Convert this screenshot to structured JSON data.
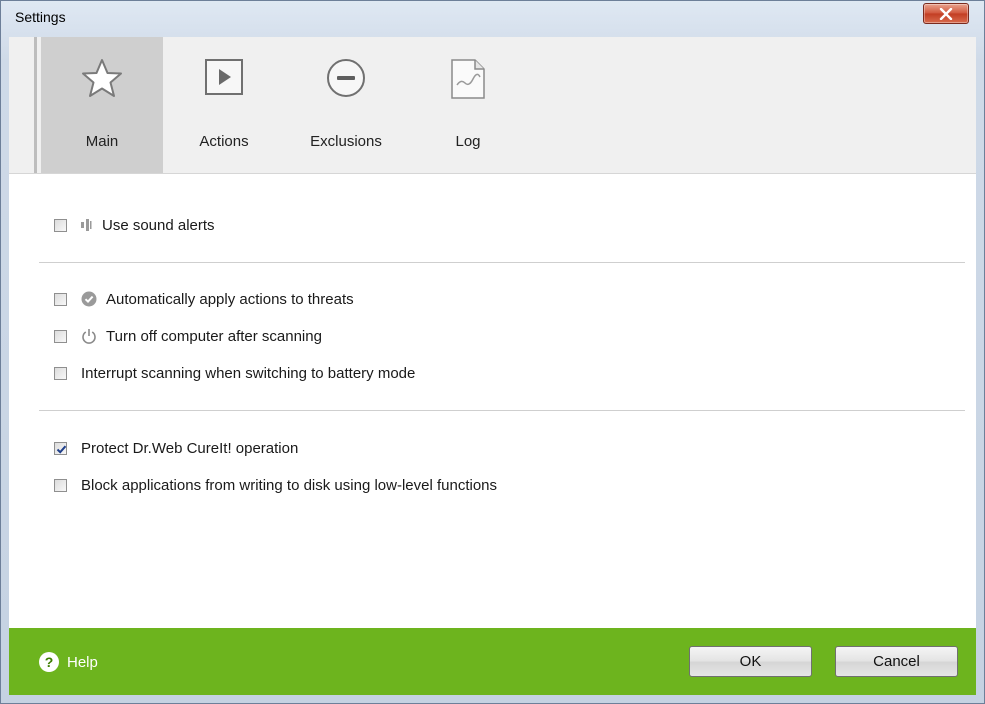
{
  "window": {
    "title": "Settings"
  },
  "tabs": [
    {
      "label": "Main",
      "icon": "star-icon",
      "active": true
    },
    {
      "label": "Actions",
      "icon": "play-icon",
      "active": false
    },
    {
      "label": "Exclusions",
      "icon": "minus-circle-icon",
      "active": false
    },
    {
      "label": "Log",
      "icon": "log-document-icon",
      "active": false
    }
  ],
  "options": {
    "sound_alerts": {
      "label": "Use sound alerts",
      "checked": false,
      "icon": "speaker-icon"
    },
    "auto_apply": {
      "label": "Automatically apply actions to threats",
      "checked": false,
      "icon": "check-circle-icon"
    },
    "turn_off": {
      "label": "Turn off computer after scanning",
      "checked": false,
      "icon": "power-icon"
    },
    "interrupt_battery": {
      "label": "Interrupt scanning when switching to battery mode",
      "checked": false
    },
    "protect": {
      "label": "Protect Dr.Web CureIt! operation",
      "checked": true
    },
    "block_low_level": {
      "label": "Block applications from writing to disk using low-level functions",
      "checked": false
    }
  },
  "footer": {
    "help_label": "Help",
    "ok_label": "OK",
    "cancel_label": "Cancel",
    "accent_color": "#6db41e"
  }
}
